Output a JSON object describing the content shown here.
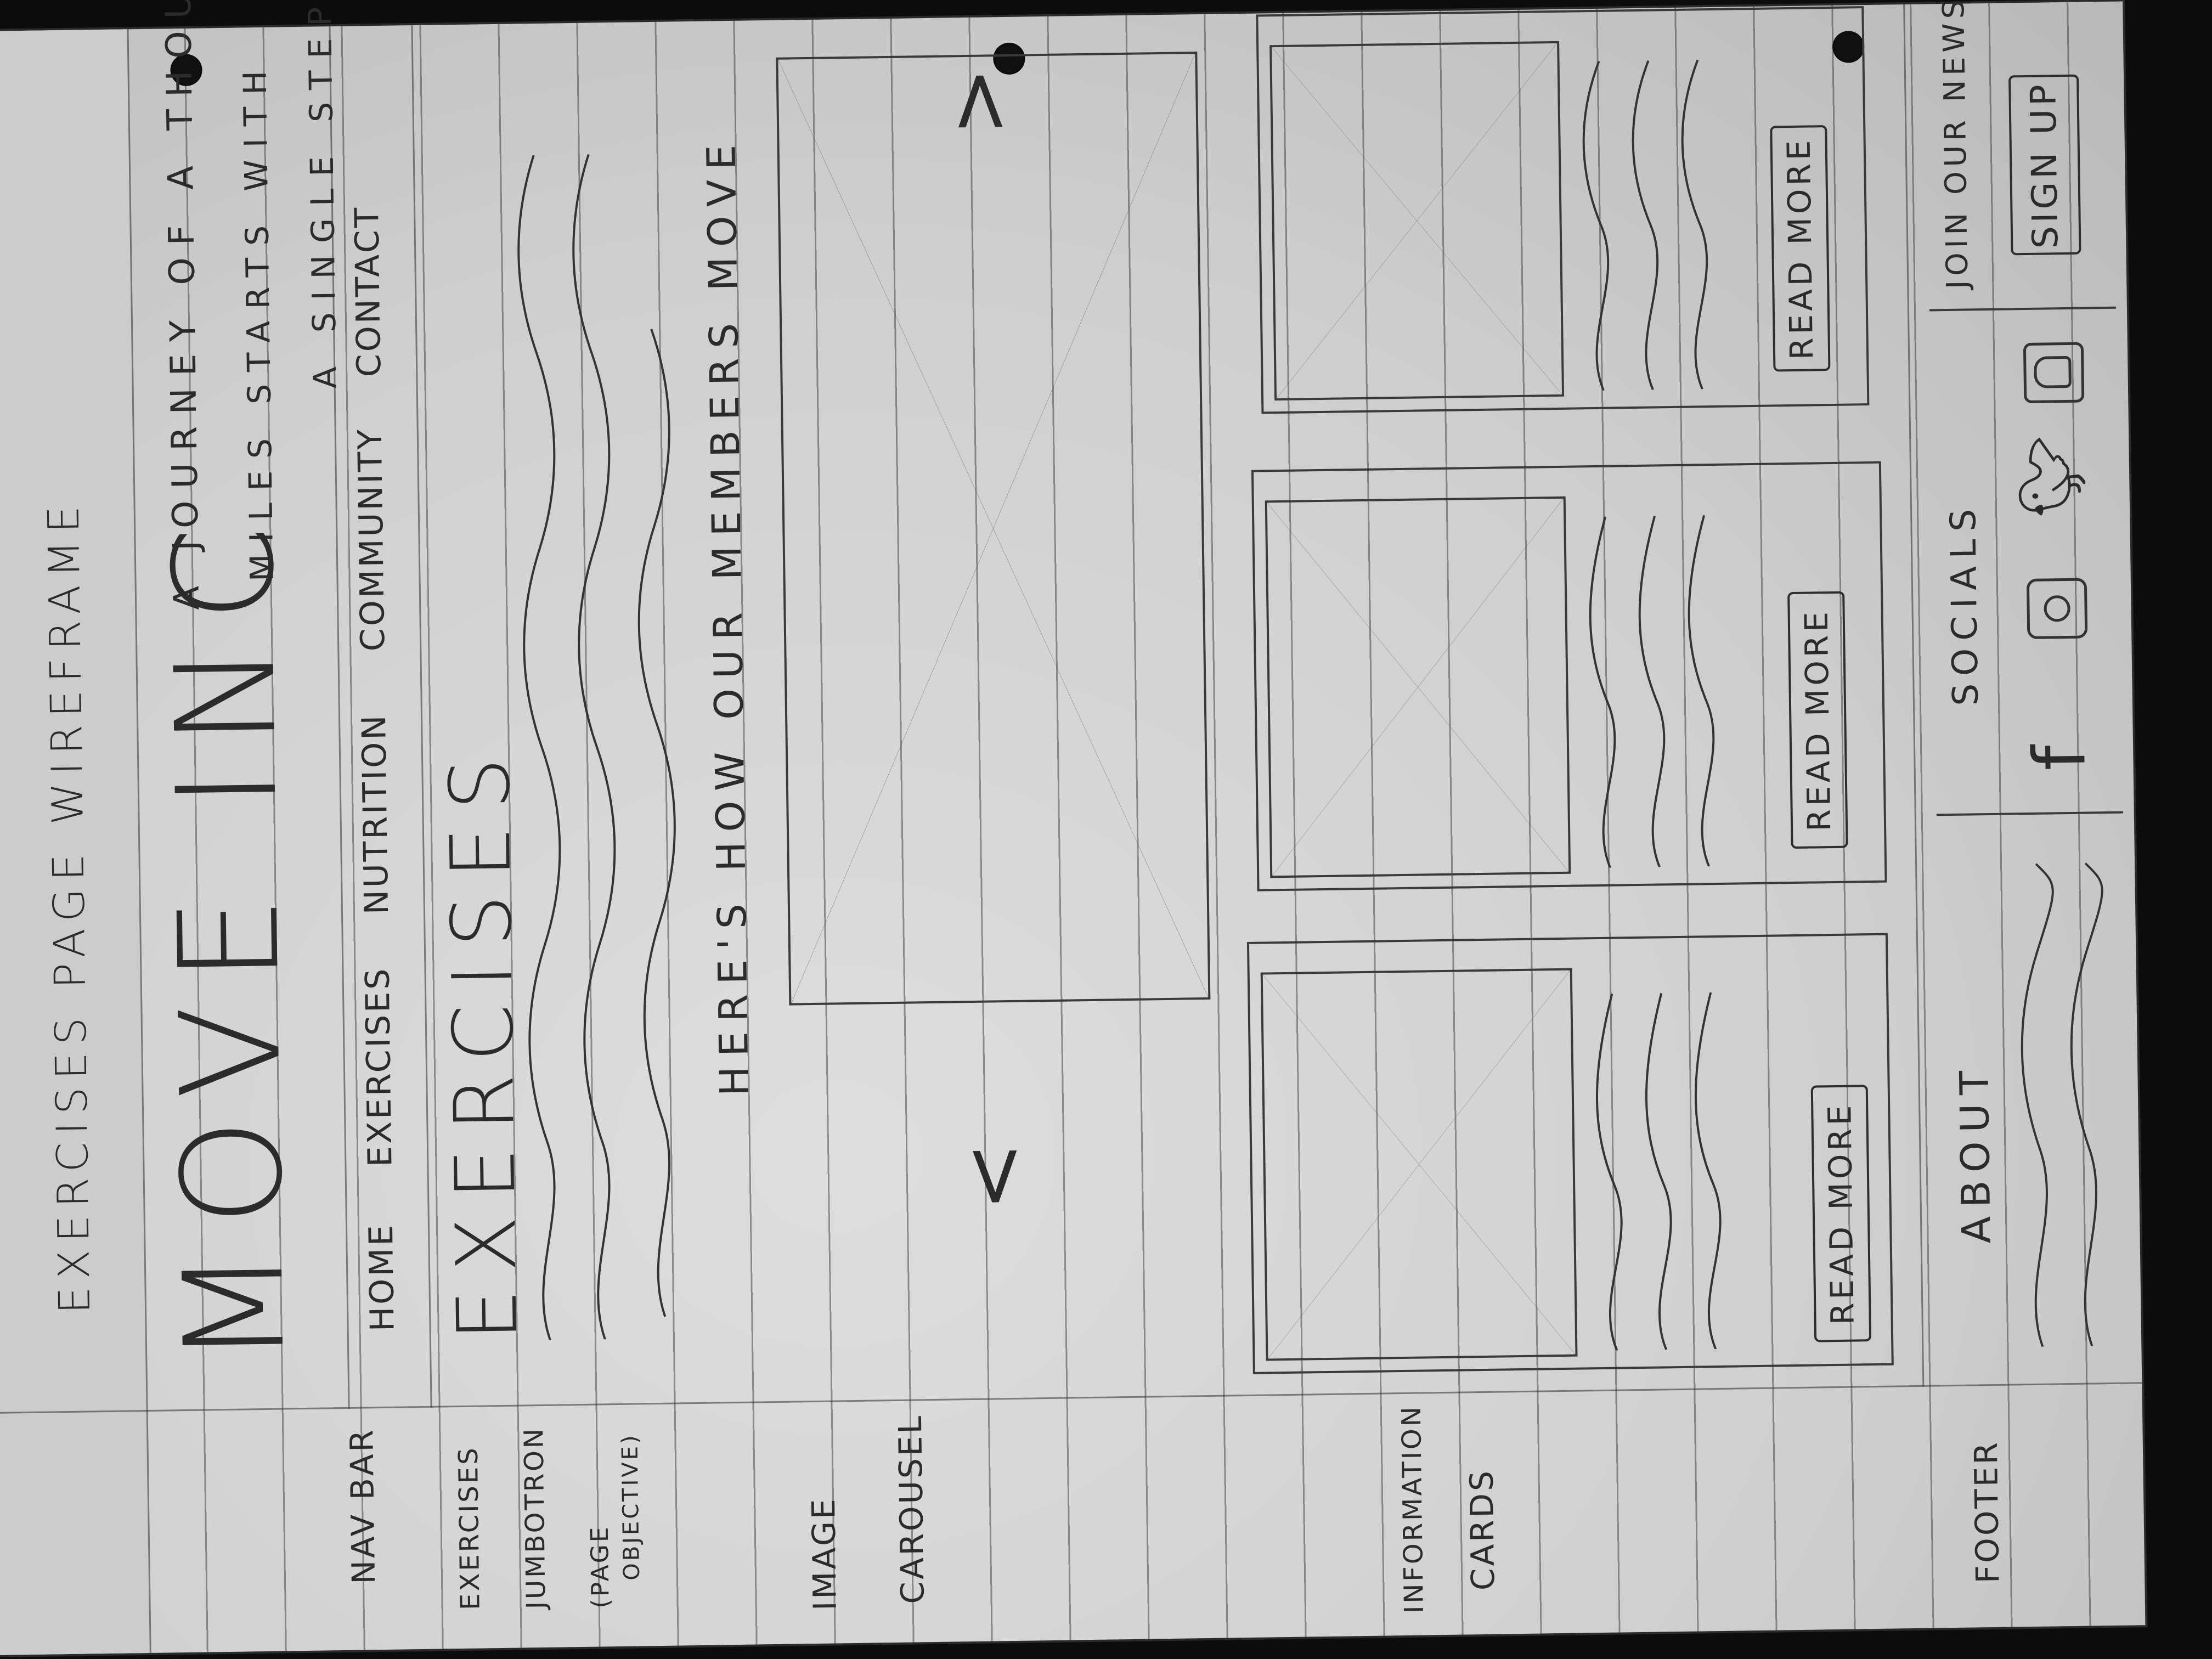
{
  "sheet": {
    "title": "EXERCISES PAGE WIREFRAME"
  },
  "margin_labels": {
    "nav_bar": "NAV BAR",
    "exercises_jumbotron": [
      "EXERCISES",
      "JUMBOTRON",
      "(PAGE",
      "OBJECTIVE)"
    ],
    "image_carousel": [
      "IMAGE",
      "CAROUSEL"
    ],
    "information_cards": [
      "INFORMATION",
      "CARDS"
    ],
    "footer": "FOOTER"
  },
  "header": {
    "logo_text": "MOVE INC",
    "tagline_lines": [
      "A JOURNEY OF A THOUSAND",
      "MILES STARTS WITH",
      "A SINGLE STEP"
    ]
  },
  "nav": {
    "items": [
      "HOME",
      "EXERCISES",
      "NUTRITION",
      "COMMUNITY",
      "CONTACT"
    ]
  },
  "jumbotron": {
    "heading": "EXERCISES"
  },
  "carousel": {
    "caption": "HERE'S HOW OUR MEMBERS MOVE",
    "prev_arrow": "<",
    "next_arrow": ">"
  },
  "cards": {
    "items": [
      {
        "button_label": "READ MORE"
      },
      {
        "button_label": "READ MORE"
      },
      {
        "button_label": "READ MORE"
      }
    ]
  },
  "footer": {
    "about_heading": "ABOUT",
    "socials_heading": "SOCIALS",
    "social_icons": [
      "facebook-icon",
      "instagram-icon",
      "twitter-icon",
      "snapchat-icon"
    ],
    "newsletter_text": "JOIN OUR NEWSLETTER",
    "signup_label": "SIGN UP"
  }
}
